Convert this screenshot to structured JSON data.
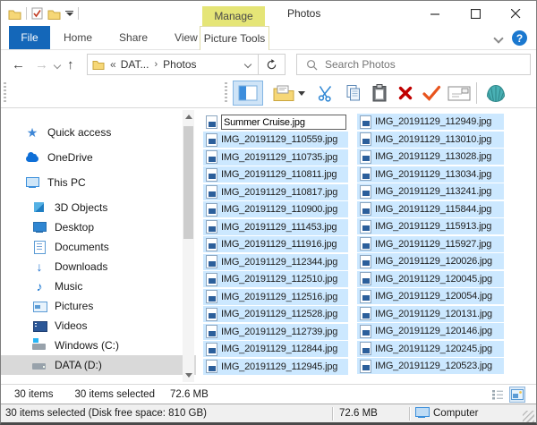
{
  "titlebar": {
    "manage_tab": "Manage",
    "window_title": "Photos"
  },
  "ribbon": {
    "file_tab": "File",
    "tabs": [
      "Home",
      "Share",
      "View"
    ],
    "contextual_tab": "Picture Tools",
    "help_label": "?"
  },
  "navbar": {
    "breadcrumb": {
      "root_hint": "«",
      "parent": "DAT...",
      "separator": "›",
      "current": "Photos"
    },
    "search_placeholder": "Search Photos"
  },
  "toolbar": {
    "icons": [
      "navigation-pane",
      "new-folder",
      "cut",
      "copy",
      "paste",
      "delete",
      "check",
      "email",
      "classic-shell"
    ]
  },
  "sidebar": {
    "items": [
      {
        "label": "Quick access",
        "icon": "star",
        "level": 0
      },
      {
        "label": "OneDrive",
        "icon": "cloud",
        "level": 0
      },
      {
        "label": "This PC",
        "icon": "pc",
        "level": 0
      },
      {
        "label": "3D Objects",
        "icon": "cube",
        "level": 1
      },
      {
        "label": "Desktop",
        "icon": "desktop",
        "level": 1
      },
      {
        "label": "Documents",
        "icon": "document",
        "level": 1
      },
      {
        "label": "Downloads",
        "icon": "download",
        "level": 1
      },
      {
        "label": "Music",
        "icon": "music",
        "level": 1
      },
      {
        "label": "Pictures",
        "icon": "picture",
        "level": 1
      },
      {
        "label": "Videos",
        "icon": "video",
        "level": 1
      },
      {
        "label": "Windows (C:)",
        "icon": "drive-os",
        "level": 1
      },
      {
        "label": "DATA (D:)",
        "icon": "drive",
        "level": 1,
        "selected": true
      }
    ]
  },
  "filelist": {
    "rename_value": "Summer Cruise.jpg",
    "column1": [
      "IMG_20191129_110559.jpg",
      "IMG_20191129_110735.jpg",
      "IMG_20191129_110811.jpg",
      "IMG_20191129_110817.jpg",
      "IMG_20191129_110900.jpg",
      "IMG_20191129_111453.jpg",
      "IMG_20191129_111916.jpg",
      "IMG_20191129_112344.jpg",
      "IMG_20191129_112510.jpg",
      "IMG_20191129_112516.jpg",
      "IMG_20191129_112528.jpg",
      "IMG_20191129_112739.jpg",
      "IMG_20191129_112844.jpg",
      "IMG_20191129_112945.jpg"
    ],
    "column2": [
      "IMG_20191129_112949.jpg",
      "IMG_20191129_113010.jpg",
      "IMG_20191129_113028.jpg",
      "IMG_20191129_113034.jpg",
      "IMG_20191129_113241.jpg",
      "IMG_20191129_115844.jpg",
      "IMG_20191129_115913.jpg",
      "IMG_20191129_115927.jpg",
      "IMG_20191129_120026.jpg",
      "IMG_20191129_120045.jpg",
      "IMG_20191129_120054.jpg",
      "IMG_20191129_120131.jpg",
      "IMG_20191129_120146.jpg",
      "IMG_20191129_120245.jpg",
      "IMG_20191129_120523.jpg"
    ]
  },
  "statusbar": {
    "count": "30 items",
    "selected": "30 items selected",
    "size": "72.6 MB"
  },
  "classic_statusbar": {
    "selection_info": "30 items selected (Disk free space: 810 GB)",
    "size": "72.6 MB",
    "zone": "Computer"
  },
  "colors": {
    "accent_blue": "#1467b9",
    "manage_yellow": "#e5e577",
    "selection_blue": "#cce8ff",
    "sidebar_selected": "#d9d9d9"
  }
}
